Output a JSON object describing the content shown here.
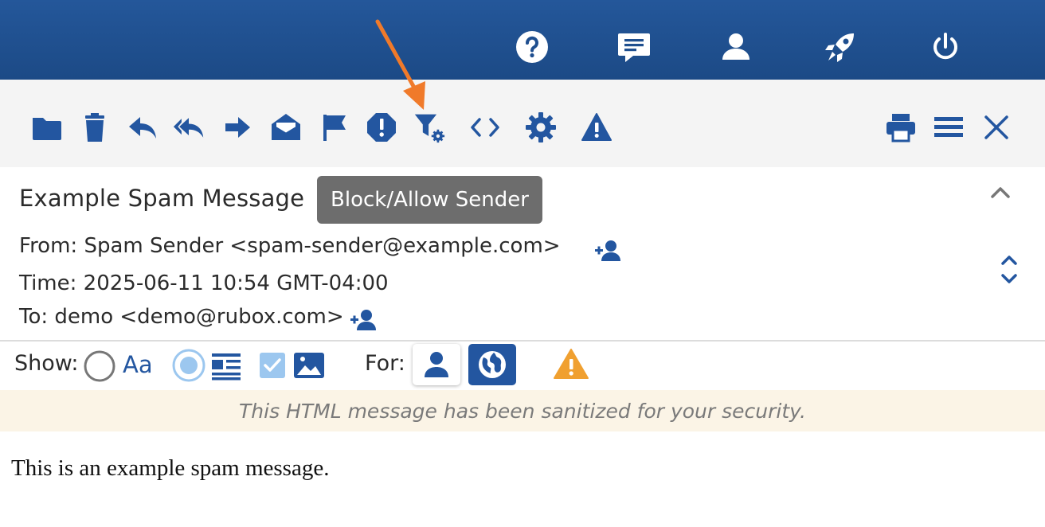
{
  "colors": {
    "topbar": "#1f4f8f",
    "icon_blue": "#2356a0",
    "toolbar_bg": "#f4f4f4",
    "tooltip_bg": "#6d6d6d",
    "notice_bg": "#fbf4e6",
    "warning_orange": "#f0a030",
    "annotation_arrow": "#f07a2a"
  },
  "topbar": {
    "icons": [
      "help-icon",
      "chat-icon",
      "user-icon",
      "rocket-icon",
      "power-icon"
    ]
  },
  "toolbar": {
    "icons": [
      "folder-icon",
      "trash-icon",
      "reply-icon",
      "reply-all-icon",
      "forward-icon",
      "mark-read-icon",
      "flag-icon",
      "report-icon",
      "filter-settings-icon",
      "source-code-icon",
      "settings-icon",
      "warning-icon",
      "print-icon",
      "menu-icon",
      "close-icon"
    ],
    "tooltip": "Block/Allow Sender"
  },
  "message": {
    "subject": "Example Spam Message",
    "from": "From: Spam Sender <spam-sender@example.com>",
    "time": "Time:  2025-06-11 10:54 GMT-04:00",
    "to": "To: demo <demo@rubox.com>",
    "body": "This is an example spam message."
  },
  "show_bar": {
    "show_label": "Show:",
    "plain_text_label": "Aa",
    "for_label": "For:",
    "selected_option": "html"
  },
  "notice": "This HTML message has been sanitized for your security."
}
